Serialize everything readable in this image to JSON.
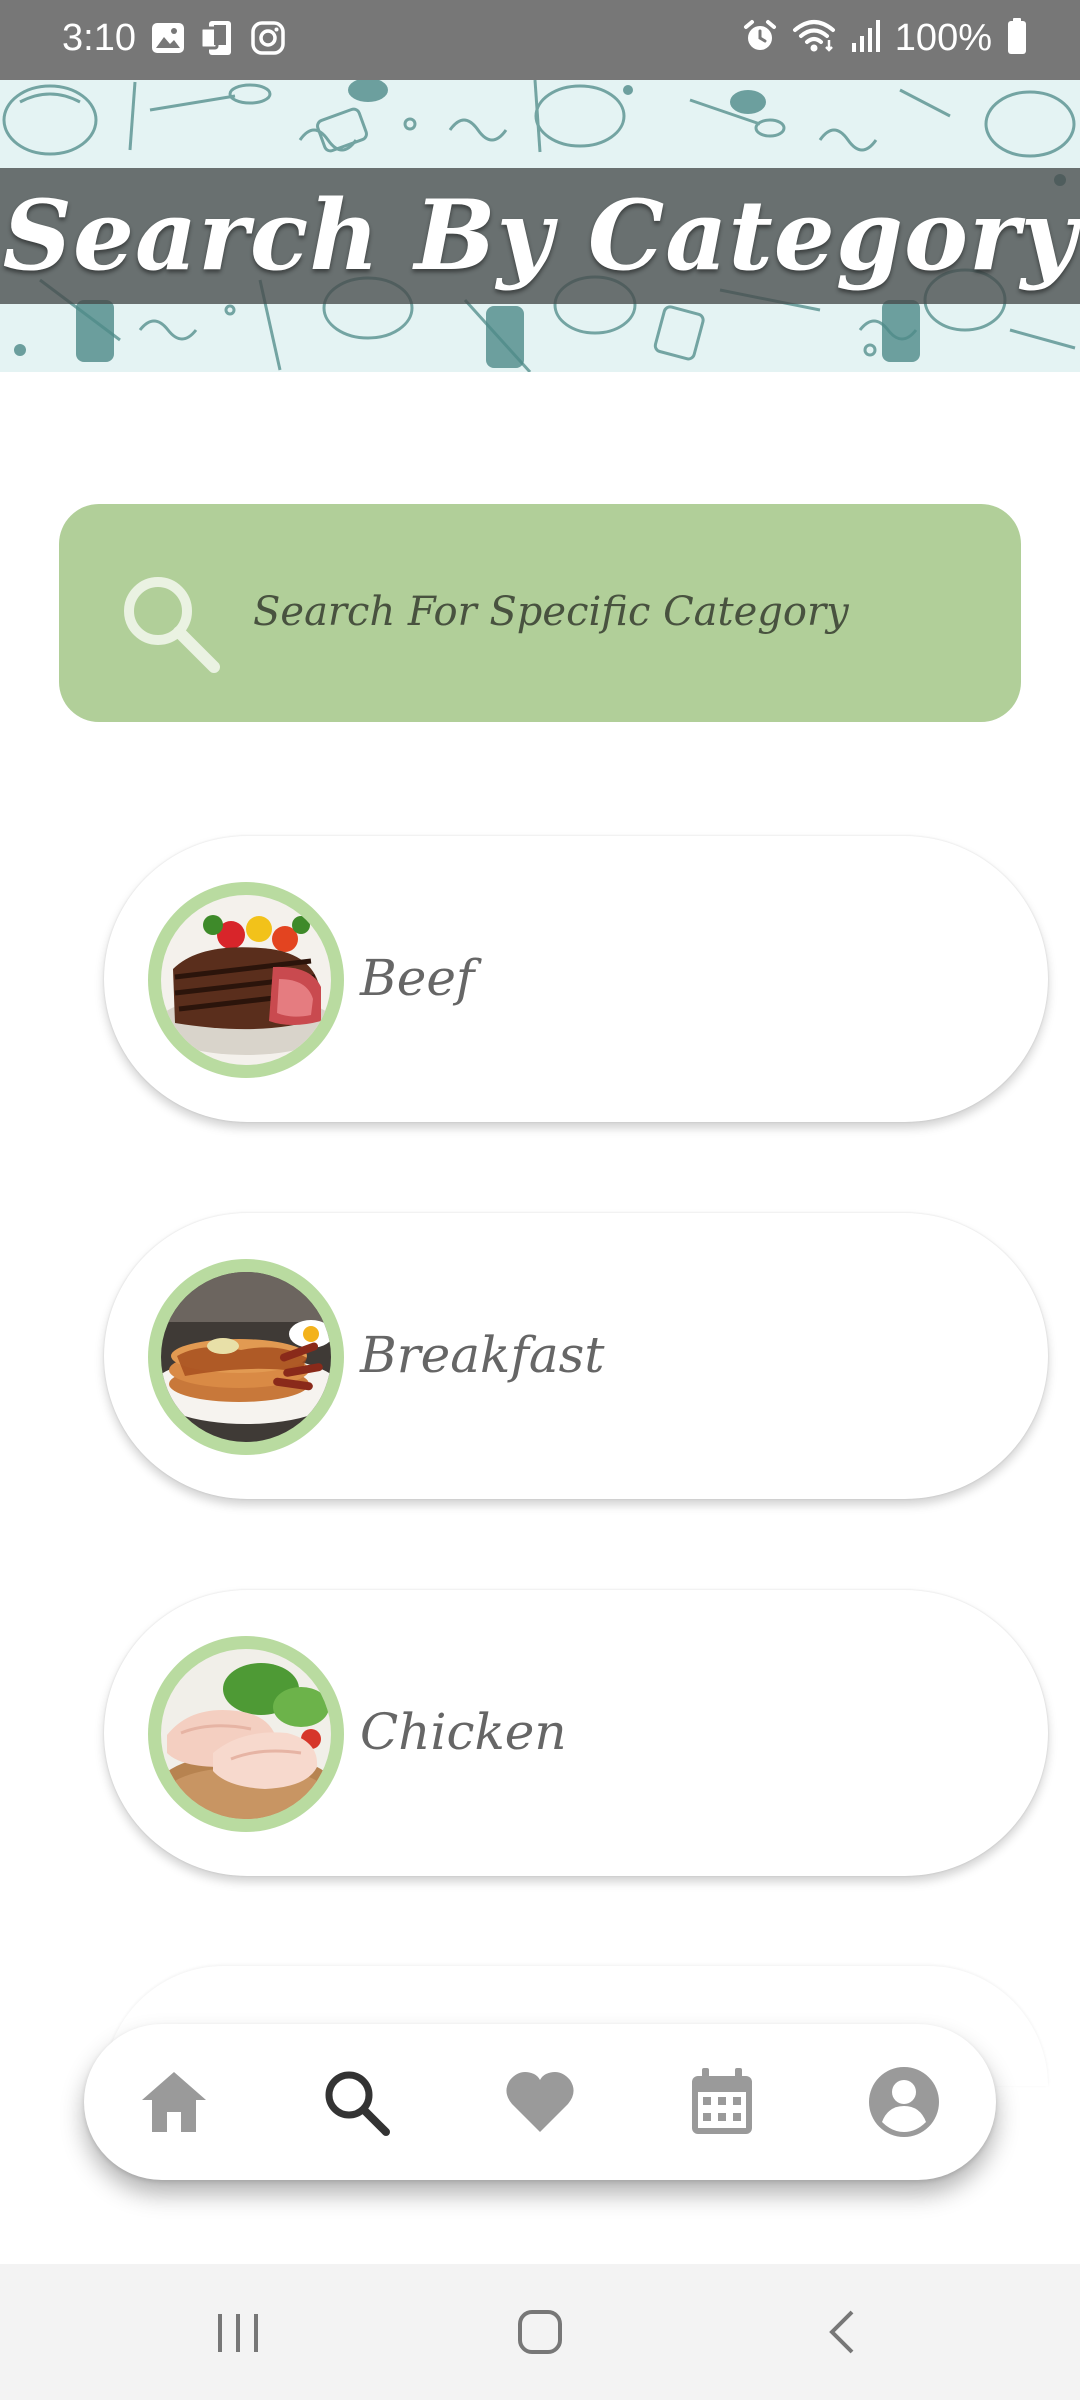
{
  "status_bar": {
    "time": "3:10",
    "battery_percent": "100%",
    "left_icons": [
      "gallery-icon",
      "notification-icon",
      "instagram-icon"
    ],
    "right_icons": [
      "alarm-icon",
      "wifi-icon",
      "signal-icon",
      "battery-icon"
    ]
  },
  "header": {
    "title": "Search By Category",
    "banner_background": "#e4f3f3"
  },
  "search": {
    "placeholder": "Search For Specific Category",
    "icon": "search-icon",
    "background": "#b1cf99"
  },
  "categories": [
    {
      "label": "Beef",
      "image": "beef-steak-image"
    },
    {
      "label": "Breakfast",
      "image": "pancakes-image"
    },
    {
      "label": "Chicken",
      "image": "raw-chicken-image"
    }
  ],
  "bottom_nav": {
    "items": [
      {
        "icon": "home-icon",
        "active": false
      },
      {
        "icon": "search-icon",
        "active": true
      },
      {
        "icon": "heart-icon",
        "active": false
      },
      {
        "icon": "calendar-icon",
        "active": false
      },
      {
        "icon": "profile-icon",
        "active": false
      }
    ],
    "active_color": "#333333",
    "inactive_color": "#9a9a9a"
  },
  "system_nav": {
    "buttons": [
      "recent-apps-icon",
      "home-button-icon",
      "back-icon"
    ]
  },
  "colors": {
    "accent_green": "#b1cf99",
    "thumb_ring_green": "#b9dba0",
    "status_bar_gray": "#777777",
    "card_text": "#666666"
  }
}
